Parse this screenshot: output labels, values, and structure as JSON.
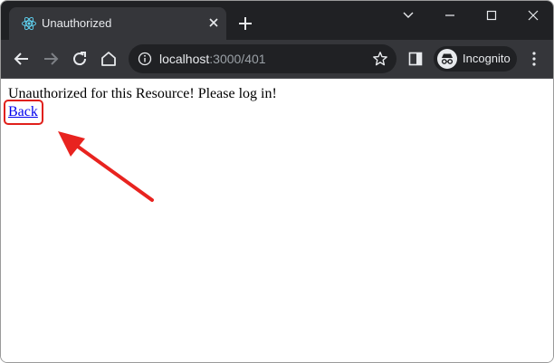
{
  "browser": {
    "tab_title": "Unauthorized",
    "url_host": "localhost",
    "url_path": ":3000/401",
    "profile_label": "Incognito",
    "icons": {
      "tab": "react-icon",
      "close": "close-icon",
      "new_tab": "plus-icon",
      "back": "arrow-left-icon",
      "forward": "arrow-right-icon",
      "reload": "reload-icon",
      "home": "home-icon",
      "info": "info-icon",
      "bookmark": "star-icon",
      "side_panel": "side-panel-icon",
      "incognito": "incognito-icon",
      "menu": "kebab-menu-icon",
      "tab_search": "chevron-down-icon",
      "minimize": "minimize-icon",
      "maximize": "maximize-icon",
      "window_close": "window-close-icon"
    }
  },
  "page": {
    "message": "Unauthorized for this Resource! Please log in!",
    "back_link": "Back"
  },
  "annotation": {
    "highlight_color": "#e0201b",
    "arrow_color": "#e8231f"
  }
}
